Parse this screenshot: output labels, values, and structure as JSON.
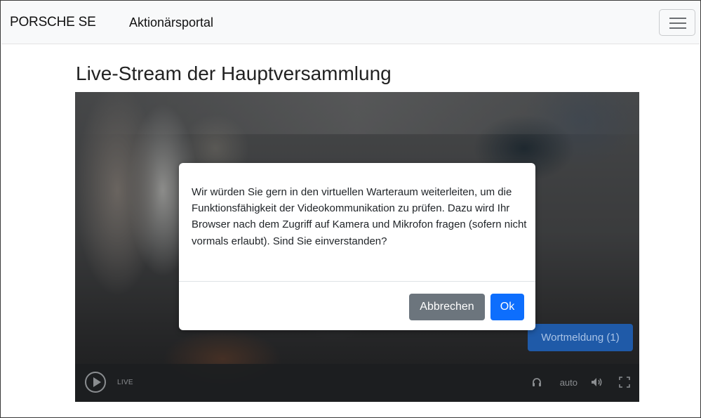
{
  "navbar": {
    "brand": "PORSCHE SE",
    "portal_title": "Aktionärsportal",
    "menu_icon": "hamburger-icon"
  },
  "page": {
    "title": "Live-Stream der Hauptversammlung"
  },
  "video": {
    "wortmeldung_label": "Wortmeldung (1)",
    "live_label": "LIVE",
    "quality_label": "auto",
    "icons": [
      "play-icon",
      "headphones-icon",
      "volume-icon",
      "fullscreen-icon"
    ]
  },
  "modal": {
    "message": "Wir würden Sie gern in den virtuellen Warteraum weiterleiten, um die Funktionsfähigkeit der Videokommunikation zu prüfen. Dazu wird Ihr Browser nach dem Zugriff auf Kamera und Mikrofon fragen (sofern nicht vormals erlaubt). Sind Sie einverstanden?",
    "cancel_label": "Abbrechen",
    "ok_label": "Ok"
  },
  "colors": {
    "primary": "#0d6efd",
    "secondary": "#6c757d",
    "wortmeldung": "#1f5aa8"
  }
}
